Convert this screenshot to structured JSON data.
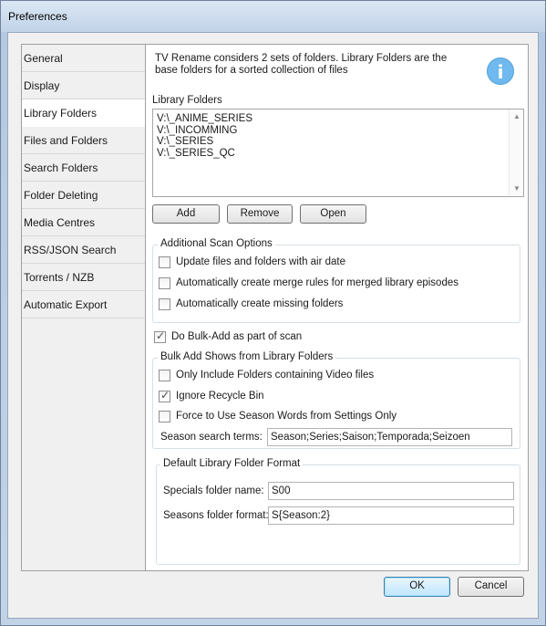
{
  "window": {
    "title": "Preferences"
  },
  "nav": {
    "items": [
      "General",
      "Display",
      "Library Folders",
      "Files and Folders",
      "Search Folders",
      "Folder Deleting",
      "Media Centres",
      "RSS/JSON Search",
      "Torrents / NZB",
      "Automatic Export"
    ],
    "active": "Library Folders"
  },
  "panel": {
    "info_line1": "TV Rename considers 2 sets of folders. Library Folders are the",
    "info_line2": "base folders for a sorted collection of files",
    "info_icon": "i",
    "library_label": "Library Folders",
    "folders": [
      "V:\\_ANIME_SERIES",
      "V:\\_INCOMMING",
      "V:\\_SERIES",
      "V:\\_SERIES_QC"
    ],
    "buttons": {
      "add": "Add",
      "remove": "Remove",
      "open": "Open"
    },
    "scan_group": {
      "title": "Additional Scan Options",
      "options": [
        {
          "label": "Update files and folders with air date",
          "checked": false
        },
        {
          "label": "Automatically create merge rules for merged library episodes",
          "checked": false
        },
        {
          "label": "Automatically create missing folders",
          "checked": false
        }
      ]
    },
    "bulk_add_scan": {
      "label": "Do Bulk-Add as part of scan",
      "checked": true
    },
    "bulk_group": {
      "title": "Bulk Add Shows from Library Folders",
      "options": [
        {
          "label": "Only Include Folders containing Video files",
          "checked": false
        },
        {
          "label": "Ignore Recycle Bin",
          "checked": true
        },
        {
          "label": "Force to Use Season Words from Settings Only",
          "checked": false
        }
      ],
      "season_terms_label": "Season search terms:",
      "season_terms_value": "Season;Series;Saison;Temporada;Seizoen"
    },
    "format_group": {
      "title": "Default Library Folder Format",
      "specials_label": "Specials folder name:",
      "specials_value": "S00",
      "seasons_label": "Seasons folder format:",
      "seasons_value": "S{Season:2}"
    }
  },
  "footer": {
    "ok": "OK",
    "cancel": "Cancel"
  },
  "check_glyph": "✓"
}
